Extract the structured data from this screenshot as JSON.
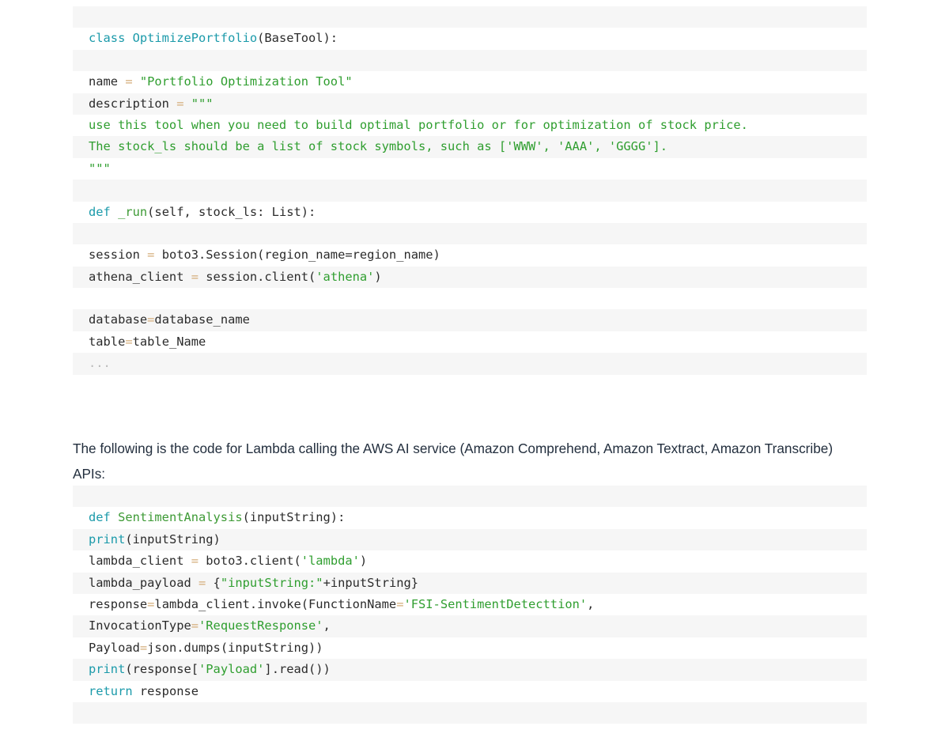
{
  "document": {
    "kind": "technical-article-excerpt",
    "paragraphs": [
      {
        "id": "lambda-ai-intro",
        "text": "The following is the code for Lambda calling the AWS AI service (Amazon Comprehend, Amazon Textract, Amazon Transcribe) APIs:"
      }
    ],
    "code_blocks": [
      {
        "id": "optimize-portfolio-tool",
        "language": "python",
        "lines": [
          {
            "tokens": []
          },
          {
            "tokens": [
              {
                "t": "class ",
                "c": "kw"
              },
              {
                "t": "OptimizePortfolio",
                "c": "name"
              },
              {
                "t": "(BaseTool):",
                "c": "txt"
              }
            ]
          },
          {
            "tokens": []
          },
          {
            "tokens": [
              {
                "t": "name ",
                "c": "txt"
              },
              {
                "t": "= ",
                "c": "op"
              },
              {
                "t": "\"Portfolio Optimization Tool\"",
                "c": "str"
              }
            ]
          },
          {
            "tokens": [
              {
                "t": "description ",
                "c": "txt"
              },
              {
                "t": "= ",
                "c": "op"
              },
              {
                "t": "\"\"\"",
                "c": "str"
              }
            ]
          },
          {
            "tokens": [
              {
                "t": "use this tool when you need to build optimal portfolio or for optimization of stock price.",
                "c": "doc"
              }
            ]
          },
          {
            "tokens": [
              {
                "t": "The stock_ls should be a list of stock symbols, such as ['WWW', 'AAA', 'GGGG'].",
                "c": "doc"
              }
            ]
          },
          {
            "tokens": [
              {
                "t": "\"\"\"",
                "c": "doc"
              }
            ]
          },
          {
            "tokens": []
          },
          {
            "tokens": [
              {
                "t": "def ",
                "c": "kw"
              },
              {
                "t": "_run",
                "c": "fn"
              },
              {
                "t": "(self, stock_ls: List):",
                "c": "txt"
              }
            ]
          },
          {
            "tokens": []
          },
          {
            "tokens": [
              {
                "t": "session ",
                "c": "txt"
              },
              {
                "t": "= ",
                "c": "op"
              },
              {
                "t": "boto3.Session(region_name=region_name)",
                "c": "txt"
              }
            ]
          },
          {
            "tokens": [
              {
                "t": "athena_client ",
                "c": "txt"
              },
              {
                "t": "= ",
                "c": "op"
              },
              {
                "t": "session.client(",
                "c": "txt"
              },
              {
                "t": "'athena'",
                "c": "str"
              },
              {
                "t": ")",
                "c": "txt"
              }
            ]
          },
          {
            "tokens": []
          },
          {
            "tokens": [
              {
                "t": "database",
                "c": "txt"
              },
              {
                "t": "=",
                "c": "op"
              },
              {
                "t": "database_name",
                "c": "txt"
              }
            ]
          },
          {
            "tokens": [
              {
                "t": "table",
                "c": "txt"
              },
              {
                "t": "=",
                "c": "op"
              },
              {
                "t": "table_Name",
                "c": "txt"
              }
            ]
          },
          {
            "tokens": [
              {
                "t": "...",
                "c": "dim"
              }
            ]
          },
          {
            "tokens": []
          }
        ]
      },
      {
        "id": "lambda-sentiment-analysis",
        "language": "python",
        "lines": [
          {
            "tokens": []
          },
          {
            "tokens": [
              {
                "t": "def ",
                "c": "kw"
              },
              {
                "t": "SentimentAnalysis",
                "c": "fn"
              },
              {
                "t": "(inputString):",
                "c": "txt"
              }
            ]
          },
          {
            "tokens": [
              {
                "t": "print",
                "c": "kw"
              },
              {
                "t": "(inputString)",
                "c": "txt"
              }
            ]
          },
          {
            "tokens": [
              {
                "t": "lambda_client ",
                "c": "txt"
              },
              {
                "t": "= ",
                "c": "op"
              },
              {
                "t": "boto3.client(",
                "c": "txt"
              },
              {
                "t": "'lambda'",
                "c": "str"
              },
              {
                "t": ")",
                "c": "txt"
              }
            ]
          },
          {
            "tokens": [
              {
                "t": "lambda_payload ",
                "c": "txt"
              },
              {
                "t": "= ",
                "c": "op"
              },
              {
                "t": "{",
                "c": "txt"
              },
              {
                "t": "\"inputString:\"",
                "c": "str"
              },
              {
                "t": "+inputString}",
                "c": "txt"
              }
            ]
          },
          {
            "tokens": [
              {
                "t": "response",
                "c": "txt"
              },
              {
                "t": "=",
                "c": "op"
              },
              {
                "t": "lambda_client.invoke(FunctionName",
                "c": "txt"
              },
              {
                "t": "=",
                "c": "op"
              },
              {
                "t": "'FSI-SentimentDetecttion'",
                "c": "str"
              },
              {
                "t": ",",
                "c": "txt"
              }
            ]
          },
          {
            "tokens": [
              {
                "t": "InvocationType",
                "c": "txt"
              },
              {
                "t": "=",
                "c": "op"
              },
              {
                "t": "'RequestResponse'",
                "c": "str"
              },
              {
                "t": ",",
                "c": "txt"
              }
            ]
          },
          {
            "tokens": [
              {
                "t": "Payload",
                "c": "txt"
              },
              {
                "t": "=",
                "c": "op"
              },
              {
                "t": "json.dumps(inputString))",
                "c": "txt"
              }
            ]
          },
          {
            "tokens": [
              {
                "t": "print",
                "c": "kw"
              },
              {
                "t": "(response[",
                "c": "txt"
              },
              {
                "t": "'Payload'",
                "c": "str"
              },
              {
                "t": "].read())",
                "c": "txt"
              }
            ]
          },
          {
            "tokens": [
              {
                "t": "return ",
                "c": "kw"
              },
              {
                "t": "response",
                "c": "txt"
              }
            ]
          },
          {
            "tokens": []
          }
        ]
      }
    ]
  },
  "colors": {
    "page_background": "#ffffff",
    "code_row_stripe": "#f6f6f6",
    "code_row_plain": "#ffffff",
    "keyword": "#1b9aaa",
    "class_name": "#1b9aaa",
    "function_name": "#3d9a35",
    "string": "#2f9e2f",
    "docstring": "#2f9e2f",
    "operator": "#d4ac7a",
    "ellipsis": "#b9b9b9",
    "code_text": "#2b2b2b",
    "body_text": "#232f3e"
  }
}
